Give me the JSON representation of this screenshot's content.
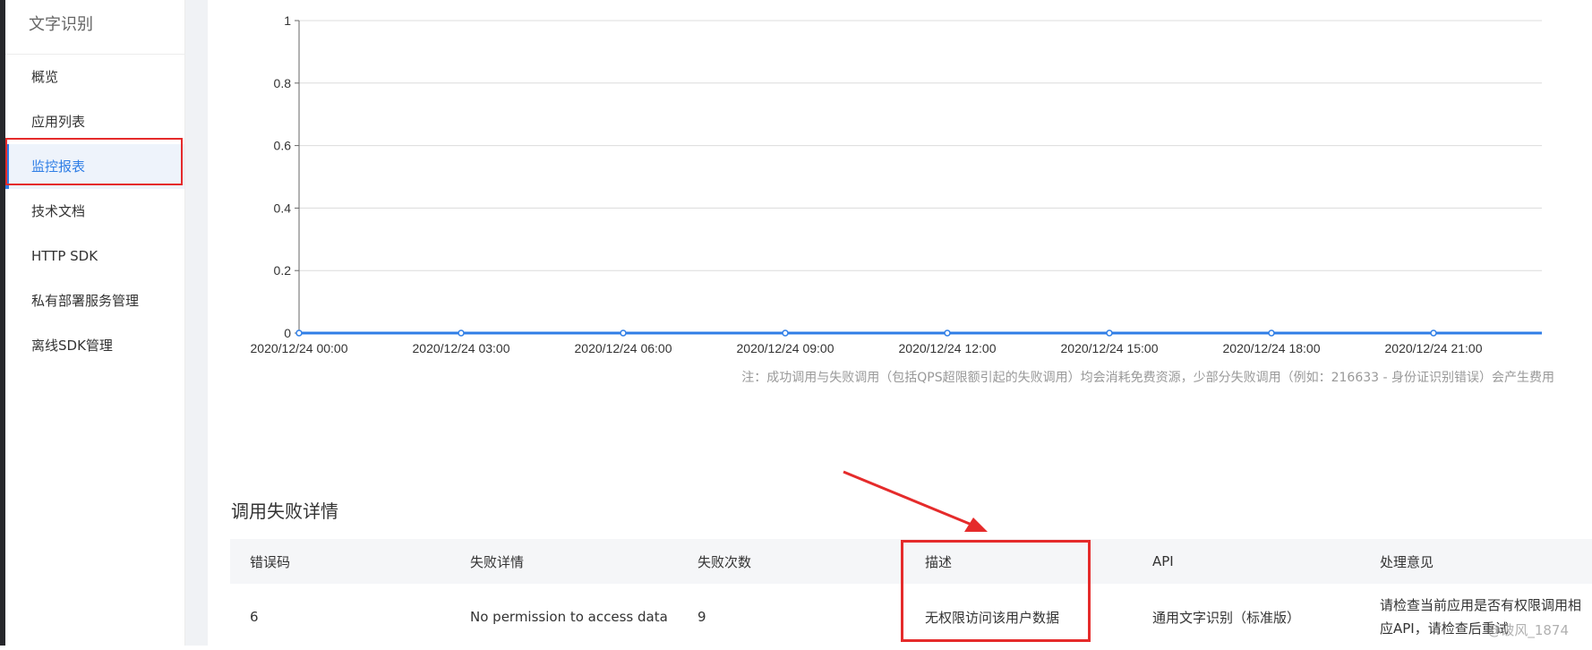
{
  "sidebar": {
    "title": "文字识别",
    "items": [
      {
        "label": "概览"
      },
      {
        "label": "应用列表"
      },
      {
        "label": "监控报表",
        "active": true
      },
      {
        "label": "技术文档"
      },
      {
        "label": "HTTP SDK"
      },
      {
        "label": "私有部署服务管理"
      },
      {
        "label": "离线SDK管理"
      }
    ]
  },
  "chart_data": {
    "type": "line",
    "x": [
      "2020/12/24 00:00",
      "2020/12/24 03:00",
      "2020/12/24 06:00",
      "2020/12/24 09:00",
      "2020/12/24 12:00",
      "2020/12/24 15:00",
      "2020/12/24 18:00",
      "2020/12/24 21:00"
    ],
    "categories": [
      "2020/12/24 00:00",
      "2020/12/24 03:00",
      "2020/12/24 06:00",
      "2020/12/24 09:00",
      "2020/12/24 12:00",
      "2020/12/24 15:00",
      "2020/12/24 18:00",
      "2020/12/24 21:00"
    ],
    "y_ticks": [
      "0",
      "0.2",
      "0.4",
      "0.6",
      "0.8",
      "1"
    ],
    "series": [
      {
        "values": [
          0,
          0,
          0,
          0,
          0,
          0,
          0,
          0
        ],
        "color": "#2f7ee6"
      }
    ],
    "ylim": [
      0,
      1
    ],
    "grid": true
  },
  "chart_note": "注：成功调用与失败调用（包括QPS超限额引起的失败调用）均会消耗免费资源，少部分失败调用（例如：216633 - 身份证识别错误）会产生费用",
  "failure_section": {
    "title": "调用失败详情",
    "columns": [
      "错误码",
      "失败详情",
      "失败次数",
      "描述",
      "API",
      "处理意见"
    ],
    "rows": [
      {
        "code": "6",
        "detail": "No permission to access data",
        "count": "9",
        "desc": "无权限访问该用户数据",
        "api": "通用文字识别（标准版）",
        "advice": "请检查当前应用是否有权限调用相应API，请检查后重试"
      }
    ]
  },
  "watermark": "@破风_1874",
  "colors": {
    "accent": "#2f7ee6",
    "highlight": "#e52b2b"
  }
}
